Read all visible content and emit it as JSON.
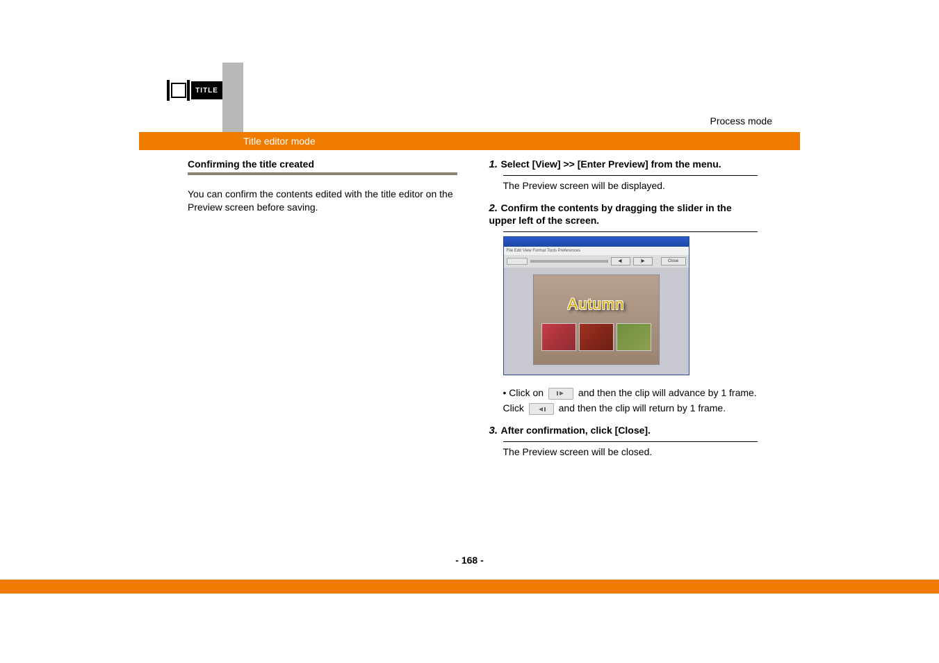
{
  "header": {
    "title_icon_label": "TITLE",
    "process_mode": "Process mode",
    "mode_label": "Title editor mode"
  },
  "left_col": {
    "heading": "Confirming the title created",
    "paragraph": "You can confirm the contents edited with the title editor on the Preview screen before saving."
  },
  "right_col": {
    "step1_num": "1.",
    "step1_text": "Select [View] >> [Enter Preview] from the menu.",
    "step1_sub": "The Preview screen will be displayed.",
    "step2_num": "2.",
    "step2_text": "Confirm the contents by dragging the slider in the upper left of the screen.",
    "bullet_prefix": "• Click on ",
    "bullet_mid1": " and then the clip will advance by 1 frame. Click ",
    "bullet_mid2": " and then the clip will return by 1 frame.",
    "step3_num": "3.",
    "step3_text": "After confirmation, click [Close].",
    "step3_sub": "The Preview screen will be closed."
  },
  "screenshot": {
    "menu": "File Edit View Format Tools Preferences",
    "close_btn": "Close",
    "autumn": "Autumn"
  },
  "footer": {
    "page": "- 168 -"
  }
}
